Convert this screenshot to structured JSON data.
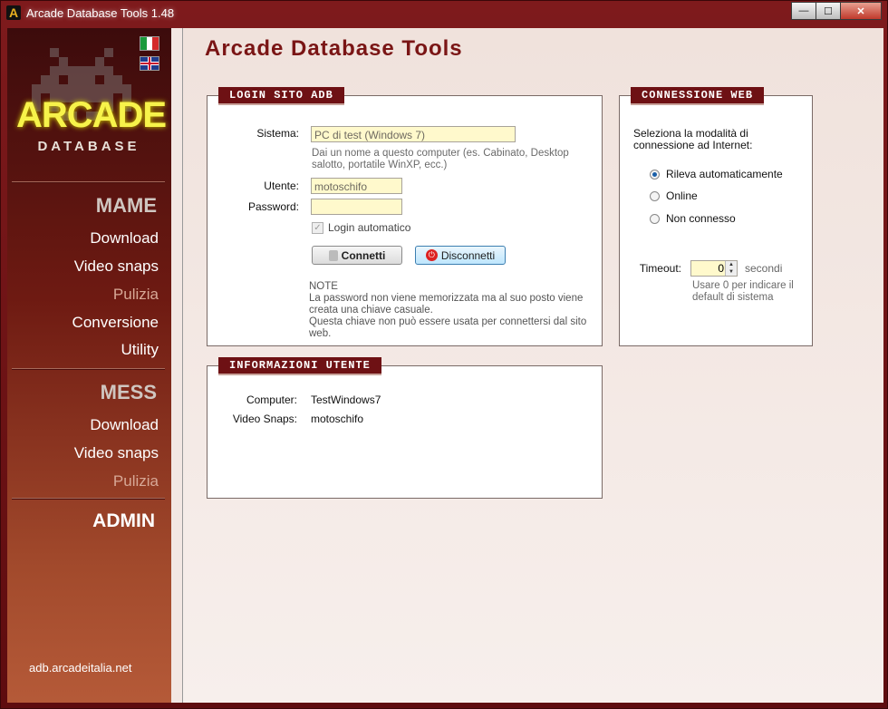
{
  "window": {
    "title": "Arcade Database Tools 1.48",
    "app_icon": "A",
    "controls": {
      "minimize": "—",
      "maximize": "☐",
      "close": "✕"
    }
  },
  "sidebar": {
    "logo_main": "ARCADE",
    "logo_sub": "DATABASE",
    "mame": {
      "title": "MAME",
      "items": [
        {
          "label": "Download",
          "enabled": true
        },
        {
          "label": "Video snaps",
          "enabled": true
        },
        {
          "label": "Pulizia",
          "enabled": false
        },
        {
          "label": "Conversione",
          "enabled": true
        },
        {
          "label": "Utility",
          "enabled": true
        }
      ]
    },
    "mess": {
      "title": "MESS",
      "items": [
        {
          "label": "Download",
          "enabled": true
        },
        {
          "label": "Video snaps",
          "enabled": true
        },
        {
          "label": "Pulizia",
          "enabled": false
        }
      ]
    },
    "admin": "ADMIN",
    "site": "adb.arcadeitalia.net"
  },
  "main": {
    "title": "Arcade Database Tools",
    "login": {
      "header": "LOGIN SITO ADB",
      "sistema_label": "Sistema:",
      "sistema_value": "PC di test (Windows 7)",
      "sistema_hint": "Dai un nome a questo computer (es. Cabinato, Desktop salotto, portatile WinXP, ecc.)",
      "utente_label": "Utente:",
      "utente_value": "motoschifo",
      "password_label": "Password:",
      "password_value": "",
      "auto_login_label": "Login automatico",
      "auto_login_checked": true,
      "connect_button": "Connetti",
      "disconnect_button": "Disconnetti",
      "note_title": "NOTE",
      "note_line1": "La password non viene memorizzata ma al suo posto viene creata una chiave casuale.",
      "note_line2": "Questa chiave non può essere usata per connettersi dal sito web."
    },
    "web": {
      "header": "CONNESSIONE WEB",
      "description": "Seleziona la modalità di connessione ad Internet:",
      "options": [
        {
          "label": "Rileva automaticamente",
          "selected": true
        },
        {
          "label": "Online",
          "selected": false
        },
        {
          "label": "Non connesso",
          "selected": false
        }
      ],
      "timeout_label": "Timeout:",
      "timeout_value": "0",
      "timeout_unit": "secondi",
      "timeout_hint": "Usare 0 per indicare il default di sistema"
    },
    "user_info": {
      "header": "INFORMAZIONI UTENTE",
      "computer_label": "Computer:",
      "computer_value": "TestWindows7",
      "snaps_label": "Video Snaps:",
      "snaps_value": "motoschifo"
    }
  },
  "colors": {
    "accent": "#6e1114",
    "title": "#7a1515",
    "logo": "#f7f34a",
    "field_bg": "#fff9cc"
  }
}
